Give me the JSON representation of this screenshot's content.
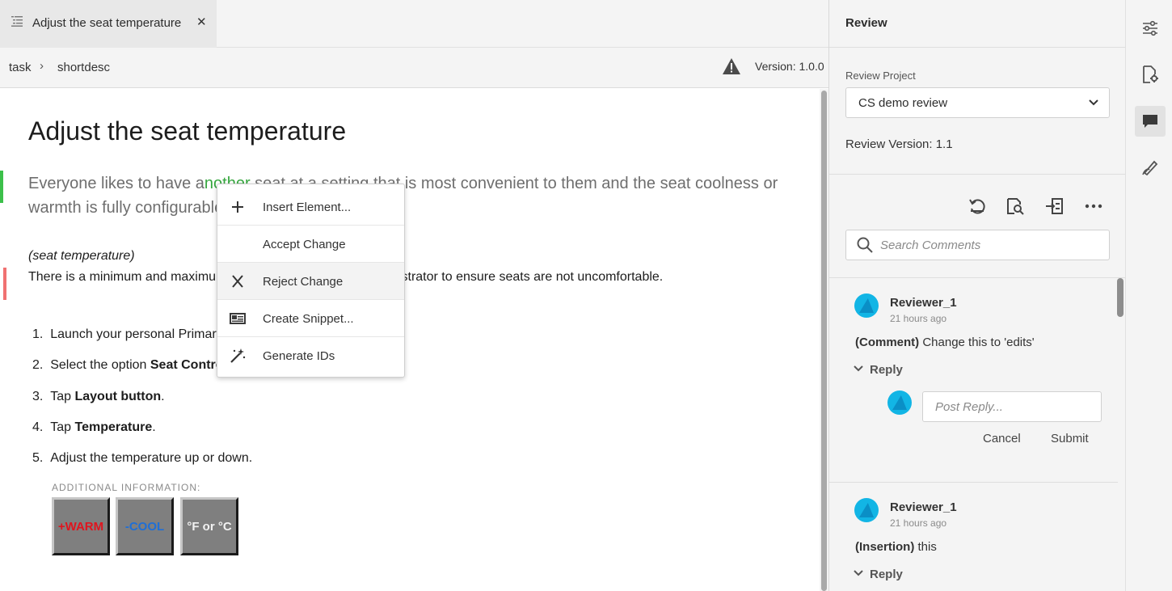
{
  "editor": {
    "tab": {
      "title": "Adjust the seat temperature",
      "close": "✕"
    },
    "breadcrumb": [
      "task",
      "shortdesc"
    ],
    "breadcrumb_sep": "›",
    "version": "Version: 1.0.0",
    "doc": {
      "title": "Adjust the seat temperature",
      "shortdesc_before": "Everyone likes to have a",
      "shortdesc_inserted": "nother",
      "shortdesc_after": " seat at a setting that is most convenient to them and the seat coolness or warmth is fully configurable.",
      "context_label": "(seat temperature)",
      "context_text": "There is a minimum and maximum temperature set by the administrator to ensure seats are not uncomfortable.",
      "steps": [
        {
          "num": "1.",
          "text": "Launch your personal Primary Seat Control panel.",
          "bold": ""
        },
        {
          "num": "2.",
          "text": "Select the option ",
          "bold": "Seat Controls"
        },
        {
          "num": "3.",
          "text": "Tap ",
          "bold": "Layout button",
          "after": "."
        },
        {
          "num": "4.",
          "text": "Tap ",
          "bold": "Temperature",
          "after": "."
        },
        {
          "num": "5.",
          "text": "Adjust the temperature up or down.",
          "bold": ""
        }
      ],
      "additional_info": "ADDITIONAL INFORMATION:",
      "keys": [
        {
          "label": "+WARM",
          "color": "#e0141e"
        },
        {
          "label": "-COOL",
          "color": "#1f6fd6"
        },
        {
          "label": "°F or °C",
          "color": "#f2f2f2"
        }
      ]
    },
    "context_menu": [
      {
        "label": "Insert Element...",
        "icon": "plus-icon"
      },
      {
        "label": "Accept Change",
        "icon": ""
      },
      {
        "label": "Reject Change",
        "icon": "close-icon"
      },
      {
        "label": "Create Snippet...",
        "icon": "snippet-icon"
      },
      {
        "label": "Generate IDs",
        "icon": "magic-wand-icon"
      }
    ]
  },
  "review": {
    "title": "Review",
    "project_label": "Review Project",
    "project_value": "CS demo review",
    "version": "Review Version: 1.1",
    "search_placeholder": "Search Comments",
    "comments": [
      {
        "author": "Reviewer_1",
        "time": "21 hours ago",
        "type": "(Comment)",
        "text": " Change this to 'edits'",
        "reply": "Reply"
      },
      {
        "author": "Reviewer_1",
        "time": "21 hours ago",
        "type": "(Insertion)",
        "text": " this",
        "reply": "Reply"
      }
    ],
    "reply_placeholder": "Post Reply...",
    "cancel": "Cancel",
    "submit": "Submit"
  },
  "colors": {
    "insertion": "#35a63e",
    "insert_bar": "#3cc04a",
    "delete_bar": "#f07171",
    "avatar": "#12b5e5"
  }
}
